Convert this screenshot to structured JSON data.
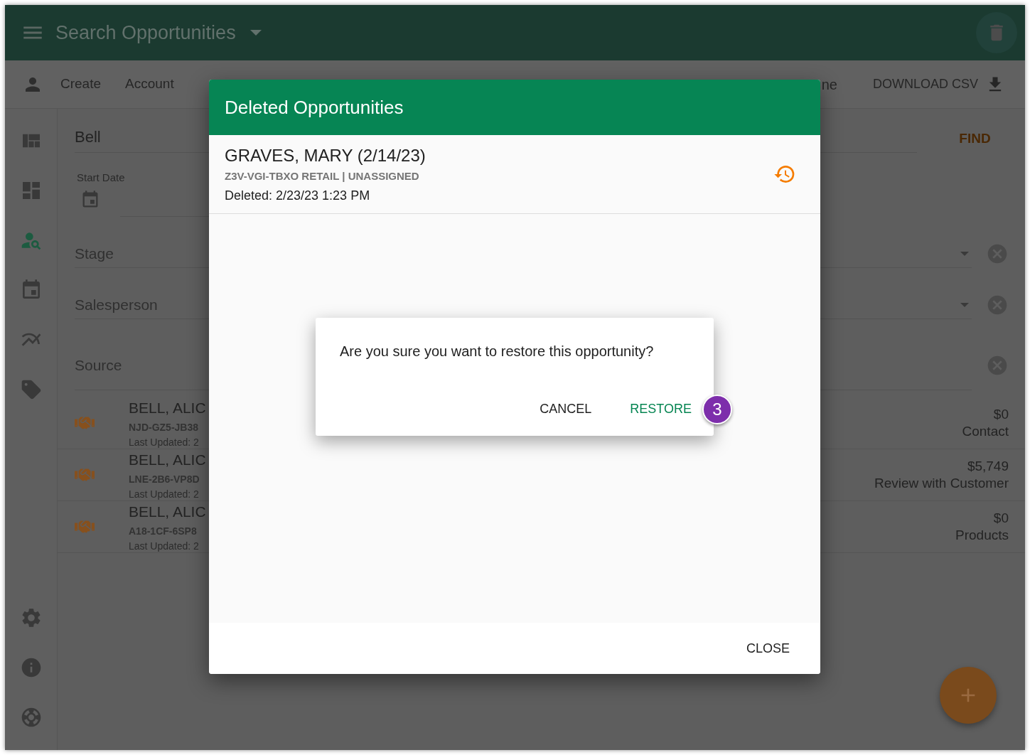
{
  "app_bar": {
    "title": "Search Opportunities"
  },
  "toolbar": {
    "links": [
      "Create",
      "Account"
    ],
    "partial_link": "ne",
    "download_button": "DOWNLOAD CSV"
  },
  "sidebar": {
    "items": [
      {
        "kind": "quilt",
        "selected": false
      },
      {
        "kind": "board",
        "selected": false
      },
      {
        "kind": "person_search",
        "selected": true
      },
      {
        "kind": "calendar",
        "selected": false
      },
      {
        "kind": "chart",
        "selected": false
      },
      {
        "kind": "tag",
        "selected": false
      }
    ],
    "footer_items": [
      {
        "kind": "settings",
        "selected": false
      },
      {
        "kind": "info",
        "selected": false
      },
      {
        "kind": "help",
        "selected": false
      }
    ]
  },
  "search": {
    "value": "Bell",
    "button": "FIND"
  },
  "filters": [
    {
      "kind": "date",
      "label": "Start Date"
    },
    {
      "kind": "select",
      "placeholder": "Stage"
    },
    {
      "kind": "select",
      "placeholder": "Salesperson"
    },
    {
      "kind": "text",
      "placeholder": "Source"
    }
  ],
  "results": [
    {
      "name": "BELL, ALIC",
      "code": "NJD-GZ5-JB38",
      "updated": "Last Updated: 2",
      "amount": "$0",
      "stage": "Contact"
    },
    {
      "name": "BELL, ALIC",
      "code": "LNE-2B6-VP8D",
      "updated": "Last Updated: 2",
      "amount": "$5,749",
      "stage": "Review with Customer"
    },
    {
      "name": "BELL, ALIC",
      "code": "A18-1CF-6SP8",
      "updated": "Last Updated: 2",
      "amount": "$0",
      "stage": "Products"
    }
  ],
  "dialog": {
    "title": "Deleted Opportunities",
    "items": [
      {
        "name": "GRAVES, MARY (2/14/23)",
        "details": "Z3V-VGI-TBXO RETAIL | UNASSIGNED",
        "deleted": "Deleted: 2/23/23 1:23 PM"
      }
    ],
    "close_button": "CLOSE"
  },
  "confirm": {
    "message": "Are you sure you want to restore this opportunity?",
    "buttons": [
      {
        "kind": "cancel",
        "label": "CANCEL"
      },
      {
        "kind": "confirm",
        "label": "RESTORE"
      }
    ],
    "step_badge": "3"
  }
}
